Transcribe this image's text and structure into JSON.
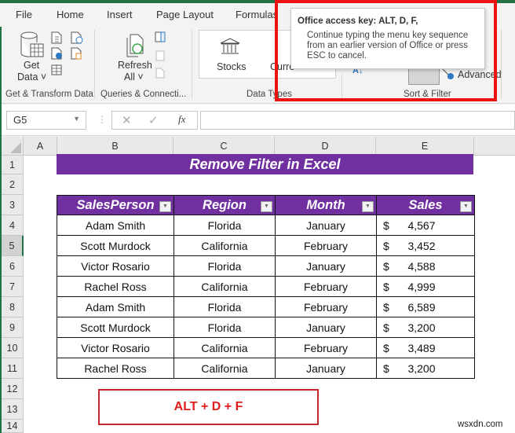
{
  "tabs": [
    "File",
    "Home",
    "Insert",
    "Page Layout",
    "Formulas"
  ],
  "ribbon": {
    "get_data": {
      "line1": "Get",
      "line2": "Data ˅"
    },
    "refresh_all": {
      "line1": "Refresh",
      "line2": "All ˅"
    },
    "stocks": "Stocks",
    "currencies": "Curre",
    "advanced": "Advanced",
    "groups": {
      "get_transform": "Get & Transform Data",
      "queries": "Queries & Connecti...",
      "data_types": "Data Types",
      "sort_filter": "Sort & Filter"
    }
  },
  "tooltip": {
    "title": "Office access key: ALT, D, F,",
    "body": "Continue typing the menu key sequence from an earlier version of Office or press ESC to cancel."
  },
  "formula_bar": {
    "name_box": "G5",
    "cancel": "✕",
    "enter": "✓",
    "fx": "fx",
    "value": ""
  },
  "columns": [
    "A",
    "B",
    "C",
    "D",
    "E"
  ],
  "rows": [
    "1",
    "2",
    "3",
    "4",
    "5",
    "6",
    "7",
    "8",
    "9",
    "10",
    "11",
    "12",
    "13",
    "14"
  ],
  "selected_row": "5",
  "sheet": {
    "title": "Remove Filter in Excel",
    "headers": [
      "SalesPerson",
      "Region",
      "Month",
      "Sales"
    ],
    "records": [
      {
        "person": "Adam Smith",
        "region": "Florida",
        "month": "January",
        "currency": "$",
        "sales": "4,567"
      },
      {
        "person": "Scott Murdock",
        "region": "California",
        "month": "February",
        "currency": "$",
        "sales": "3,452"
      },
      {
        "person": "Victor Rosario",
        "region": "Florida",
        "month": "January",
        "currency": "$",
        "sales": "4,588"
      },
      {
        "person": "Rachel Ross",
        "region": "California",
        "month": "February",
        "currency": "$",
        "sales": "4,999"
      },
      {
        "person": "Adam Smith",
        "region": "Florida",
        "month": "February",
        "currency": "$",
        "sales": "6,589"
      },
      {
        "person": "Scott Murdock",
        "region": "Florida",
        "month": "January",
        "currency": "$",
        "sales": "3,200"
      },
      {
        "person": "Victor Rosario",
        "region": "California",
        "month": "February",
        "currency": "$",
        "sales": "3,489"
      },
      {
        "person": "Rachel Ross",
        "region": "California",
        "month": "January",
        "currency": "$",
        "sales": "3,200"
      }
    ],
    "shortcut": "ALT + D + F"
  },
  "watermark": "wsxdn.com",
  "colors": {
    "accent_green": "#217346",
    "header_purple": "#7030a0",
    "highlight_red": "#ee1111",
    "shortcut_red": "#e01b1b"
  }
}
